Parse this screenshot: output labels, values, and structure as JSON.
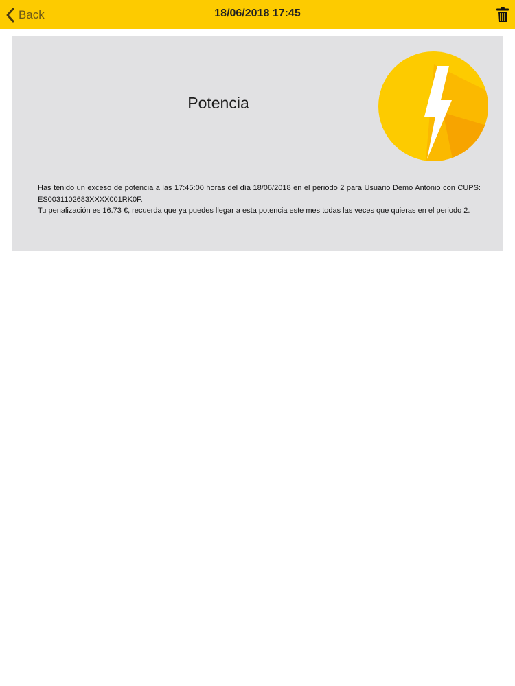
{
  "nav": {
    "back_label": "Back",
    "title": "18/06/2018 17:45",
    "accent_color": "#fdcb00"
  },
  "icons": {
    "back": "chevron-left-icon",
    "delete": "trash-icon",
    "badge": "lightning-bolt-icon"
  },
  "notification": {
    "title": "Potencia",
    "message_line1": "Has tenido un exceso de potencia a las 17:45:00 horas del día 18/06/2018 en el periodo 2 para Usuario Demo Antonio con CUPS: ES0031102683XXXX001RK0F.",
    "message_line2": "Tu penalización es 16.73 €, recuerda que ya puedes llegar a esta potencia este mes todas las veces que quieras en el periodo 2."
  }
}
